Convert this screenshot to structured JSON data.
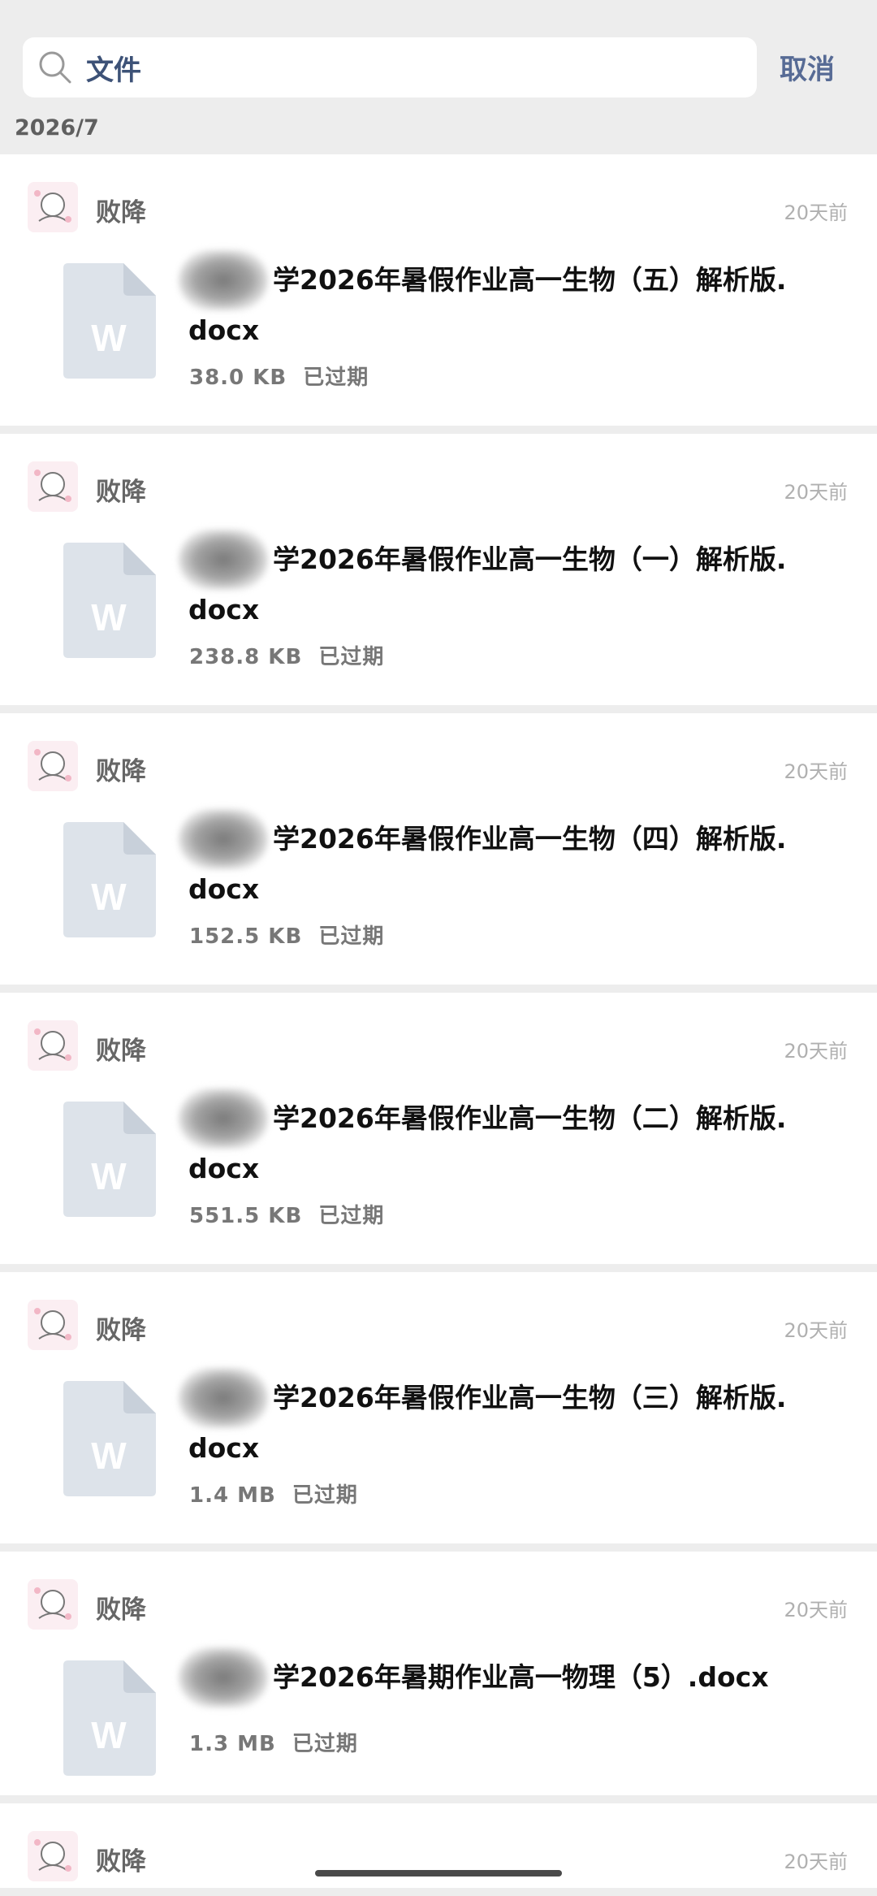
{
  "search": {
    "value": "文件",
    "cancel_label": "取消"
  },
  "date_header": "2026/7",
  "items": [
    {
      "sender": "败降",
      "time": "20天前",
      "file_name": "学2026年暑假作业高一生物（五）解析版.docx",
      "size": "38.0 KB",
      "status": "已过期"
    },
    {
      "sender": "败降",
      "time": "20天前",
      "file_name": "学2026年暑假作业高一生物（一）解析版.docx",
      "size": "238.8 KB",
      "status": "已过期"
    },
    {
      "sender": "败降",
      "time": "20天前",
      "file_name": "学2026年暑假作业高一生物（四）解析版.docx",
      "size": "152.5 KB",
      "status": "已过期"
    },
    {
      "sender": "败降",
      "time": "20天前",
      "file_name": "学2026年暑假作业高一生物（二）解析版.docx",
      "size": "551.5 KB",
      "status": "已过期"
    },
    {
      "sender": "败降",
      "time": "20天前",
      "file_name": "学2026年暑假作业高一生物（三）解析版.docx",
      "size": "1.4 MB",
      "status": "已过期"
    },
    {
      "sender": "败降",
      "time": "20天前",
      "file_name": "学2026年暑期作业高一物理（5）.docx",
      "size": "1.3 MB",
      "status": "已过期"
    },
    {
      "sender": "败降",
      "time": "20天前"
    }
  ],
  "file_icon_letter": "W",
  "colors": {
    "accent": "#576b95",
    "file_icon": "#dde3ea",
    "file_letter": "#ffffff"
  }
}
